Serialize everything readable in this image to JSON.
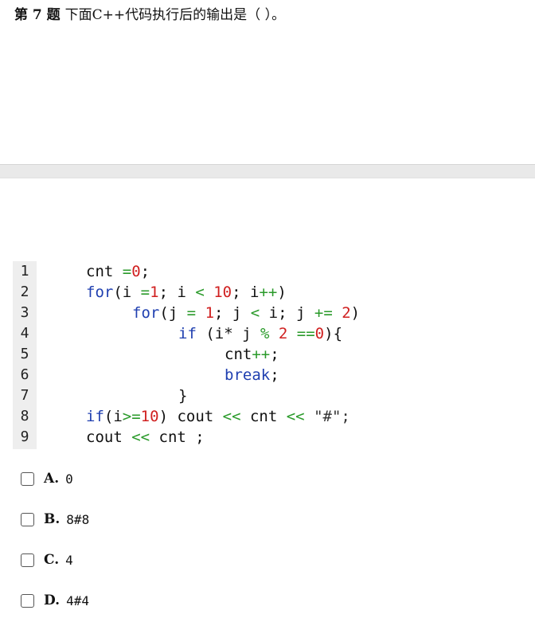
{
  "question": {
    "number": "第 7 题",
    "text": "下面C++代码执行后的输出是（   ）。"
  },
  "code": {
    "lines": [
      {
        "n": "1",
        "tokens": [
          {
            "t": "cnt ",
            "c": "plain"
          },
          {
            "t": "=",
            "c": "op"
          },
          {
            "t": "0",
            "c": "num"
          },
          {
            "t": ";",
            "c": "plain"
          }
        ],
        "indent": 0
      },
      {
        "n": "2",
        "tokens": [
          {
            "t": "for",
            "c": "kw"
          },
          {
            "t": "(i ",
            "c": "plain"
          },
          {
            "t": "=",
            "c": "op"
          },
          {
            "t": "1",
            "c": "num"
          },
          {
            "t": "; i ",
            "c": "plain"
          },
          {
            "t": "<",
            "c": "op"
          },
          {
            "t": " ",
            "c": "plain"
          },
          {
            "t": "10",
            "c": "num"
          },
          {
            "t": "; i",
            "c": "plain"
          },
          {
            "t": "++",
            "c": "op"
          },
          {
            "t": ")",
            "c": "plain"
          }
        ],
        "indent": 0
      },
      {
        "n": "3",
        "tokens": [
          {
            "t": "for",
            "c": "kw"
          },
          {
            "t": "(j ",
            "c": "plain"
          },
          {
            "t": "=",
            "c": "op"
          },
          {
            "t": " ",
            "c": "plain"
          },
          {
            "t": "1",
            "c": "num"
          },
          {
            "t": "; j ",
            "c": "plain"
          },
          {
            "t": "<",
            "c": "op"
          },
          {
            "t": " i; j ",
            "c": "plain"
          },
          {
            "t": "+=",
            "c": "op"
          },
          {
            "t": " ",
            "c": "plain"
          },
          {
            "t": "2",
            "c": "num"
          },
          {
            "t": ")",
            "c": "plain"
          }
        ],
        "indent": 1
      },
      {
        "n": "4",
        "tokens": [
          {
            "t": "if",
            "c": "kw"
          },
          {
            "t": " (i* j ",
            "c": "plain"
          },
          {
            "t": "%",
            "c": "op"
          },
          {
            "t": " ",
            "c": "plain"
          },
          {
            "t": "2",
            "c": "num"
          },
          {
            "t": " ",
            "c": "plain"
          },
          {
            "t": "==",
            "c": "op"
          },
          {
            "t": "0",
            "c": "num"
          },
          {
            "t": "){",
            "c": "plain"
          }
        ],
        "indent": 2
      },
      {
        "n": "5",
        "tokens": [
          {
            "t": "cnt",
            "c": "plain"
          },
          {
            "t": "++",
            "c": "op"
          },
          {
            "t": ";",
            "c": "plain"
          }
        ],
        "indent": 3
      },
      {
        "n": "6",
        "tokens": [
          {
            "t": "break",
            "c": "kw"
          },
          {
            "t": ";",
            "c": "plain"
          }
        ],
        "indent": 3
      },
      {
        "n": "7",
        "tokens": [
          {
            "t": "}",
            "c": "plain"
          }
        ],
        "indent": 2
      },
      {
        "n": "8",
        "tokens": [
          {
            "t": "if",
            "c": "kw"
          },
          {
            "t": "(i",
            "c": "plain"
          },
          {
            "t": ">=",
            "c": "op"
          },
          {
            "t": "10",
            "c": "num"
          },
          {
            "t": ") cout ",
            "c": "plain"
          },
          {
            "t": "<<",
            "c": "op"
          },
          {
            "t": " cnt ",
            "c": "plain"
          },
          {
            "t": "<<",
            "c": "op"
          },
          {
            "t": " \"#\";",
            "c": "str"
          }
        ],
        "indent": 0
      },
      {
        "n": "9",
        "tokens": [
          {
            "t": "cout ",
            "c": "plain"
          },
          {
            "t": "<<",
            "c": "op"
          },
          {
            "t": " cnt ;",
            "c": "plain"
          }
        ],
        "indent": 0
      }
    ]
  },
  "options": [
    {
      "letter": "A.",
      "text": "0"
    },
    {
      "letter": "B.",
      "text": "8#8"
    },
    {
      "letter": "C.",
      "text": "4"
    },
    {
      "letter": "D.",
      "text": "4#4"
    }
  ],
  "colors": {
    "keyword": "#1f3fb0",
    "operator": "#2a9a2a",
    "number": "#d02020",
    "gutter": "#eeeeee"
  }
}
